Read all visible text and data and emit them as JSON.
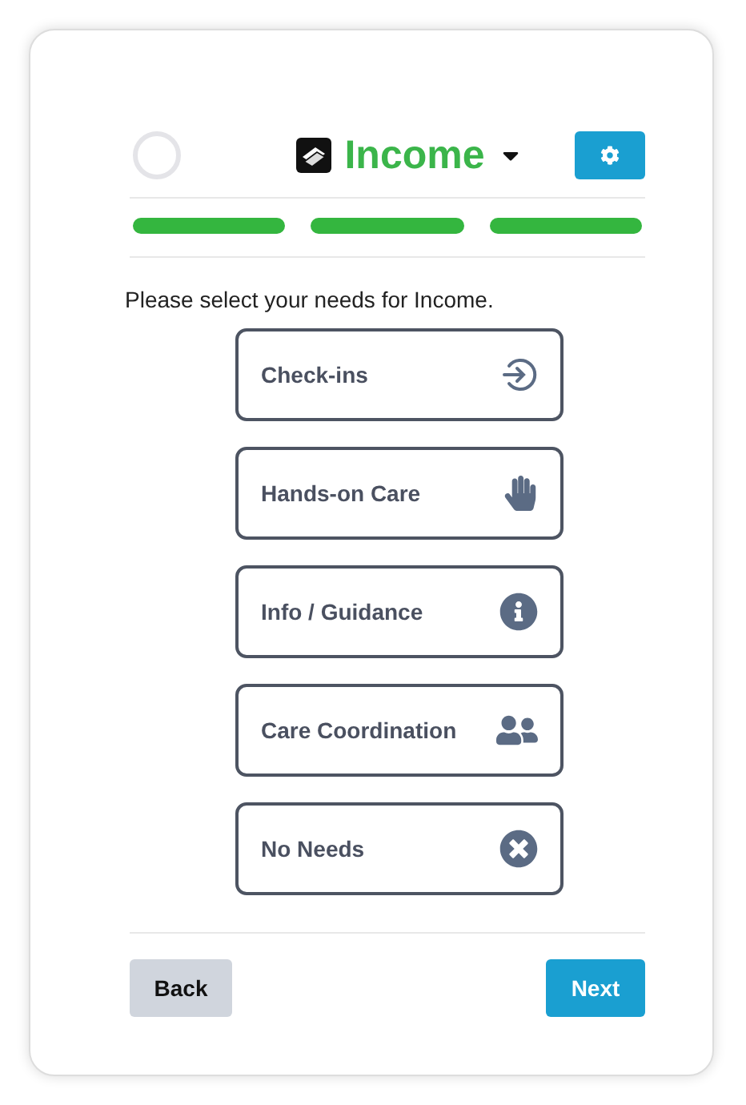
{
  "header": {
    "title": "Income"
  },
  "progress": [
    {
      "completed": true
    },
    {
      "completed": true
    },
    {
      "completed": true
    }
  ],
  "prompt": "Please select your needs for Income.",
  "options": [
    {
      "label": "Check-ins",
      "kind": "checkin",
      "selected": false
    },
    {
      "label": "Hands-on Care",
      "kind": "hand",
      "selected": false
    },
    {
      "label": "Info / Guidance",
      "kind": "info",
      "selected": false
    },
    {
      "label": "Care Coordination",
      "kind": "people",
      "selected": false
    },
    {
      "label": "No Needs",
      "kind": "none",
      "selected": false
    }
  ],
  "footer": {
    "back": "Back",
    "next": "Next"
  }
}
